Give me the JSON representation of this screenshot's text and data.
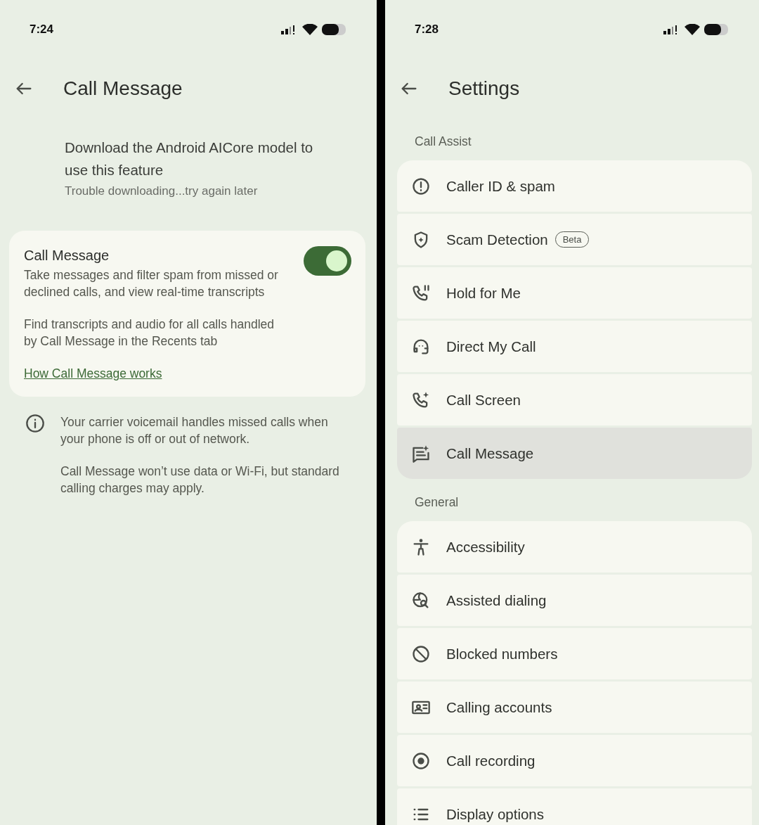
{
  "left": {
    "status_bar": {
      "time": "7:24"
    },
    "title": "Call Message",
    "notice": {
      "text": "Download the Android AICore model to use this feature",
      "status": "Trouble downloading...try again later"
    },
    "card": {
      "title": "Call Message",
      "on": true,
      "description": "Take messages and filter spam from missed or declined calls, and view real-time transcripts",
      "note": "Find transcripts and audio for all calls handled by Call Message in the Recents tab",
      "link": "How Call Message works"
    },
    "info": [
      "Your carrier voicemail handles missed calls when your phone is off or out of network.",
      "Call Message won’t use data or Wi-Fi, but standard calling charges may apply."
    ]
  },
  "right": {
    "status_bar": {
      "time": "7:28"
    },
    "title": "Settings",
    "sections": [
      {
        "header": "Call Assist",
        "items": [
          {
            "label": "Caller ID & spam",
            "kind": "alert",
            "selected": false
          },
          {
            "label": "Scam Detection",
            "kind": "shield",
            "selected": false,
            "badge": "Beta"
          },
          {
            "label": "Hold for Me",
            "kind": "hold",
            "selected": false
          },
          {
            "label": "Direct My Call",
            "kind": "agent",
            "selected": false
          },
          {
            "label": "Call Screen",
            "kind": "screen",
            "selected": false
          },
          {
            "label": "Call Message",
            "kind": "message",
            "selected": true
          }
        ]
      },
      {
        "header": "General",
        "items": [
          {
            "label": "Accessibility",
            "kind": "accessibility",
            "selected": false
          },
          {
            "label": "Assisted dialing",
            "kind": "globe",
            "selected": false
          },
          {
            "label": "Blocked numbers",
            "kind": "block",
            "selected": false
          },
          {
            "label": "Calling accounts",
            "kind": "accounts",
            "selected": false
          },
          {
            "label": "Call recording",
            "kind": "record",
            "selected": false
          },
          {
            "label": "Display options",
            "kind": "list",
            "selected": false
          }
        ]
      }
    ]
  }
}
